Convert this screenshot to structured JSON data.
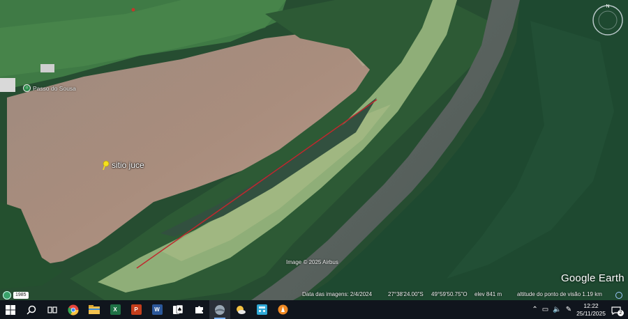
{
  "map": {
    "placemark_label": "sitio juce",
    "poi_label": "Passo do Sousa",
    "imagery_credit": "Image © 2025 Airbus",
    "compass_north": "N",
    "logo": "Google Earth"
  },
  "status": {
    "history_year": "1985",
    "imagery_date": "Data das imagens: 2/4/2024",
    "latitude": "27°38'24.00\"S",
    "longitude": "49°59'50.75\"O",
    "elevation": "elev   841 m",
    "eye_altitude": "altitude do ponto de visão   1.19 km"
  },
  "taskbar": {
    "apps": [
      {
        "name": "start-icon"
      },
      {
        "name": "search-icon"
      },
      {
        "name": "task-view-icon"
      },
      {
        "name": "chrome-icon",
        "color": "#e8453c"
      },
      {
        "name": "file-explorer-icon",
        "color": "#f2c14e"
      },
      {
        "name": "excel-icon",
        "letter": "X",
        "color": "#1e7145"
      },
      {
        "name": "powerpoint-icon",
        "letter": "P",
        "color": "#c43e1c"
      },
      {
        "name": "word-icon",
        "letter": "W",
        "color": "#2b579a"
      },
      {
        "name": "solitaire-icon"
      },
      {
        "name": "puzzle-icon"
      },
      {
        "name": "google-earth-icon",
        "color": "#9aa7b4"
      },
      {
        "name": "weather-icon",
        "color": "#f5c242"
      },
      {
        "name": "calculator-app-icon",
        "color": "#2fa8d6"
      },
      {
        "name": "vlc-icon",
        "color": "#f08a24"
      }
    ],
    "time": "12:22",
    "date": "25/11/2025",
    "notifications": "2"
  },
  "colors": {
    "measure_line": "#c0272d",
    "field": "#a88a78",
    "forest": "#1f4a2f",
    "river": "#5a6660",
    "taskbar": "#10151d"
  }
}
